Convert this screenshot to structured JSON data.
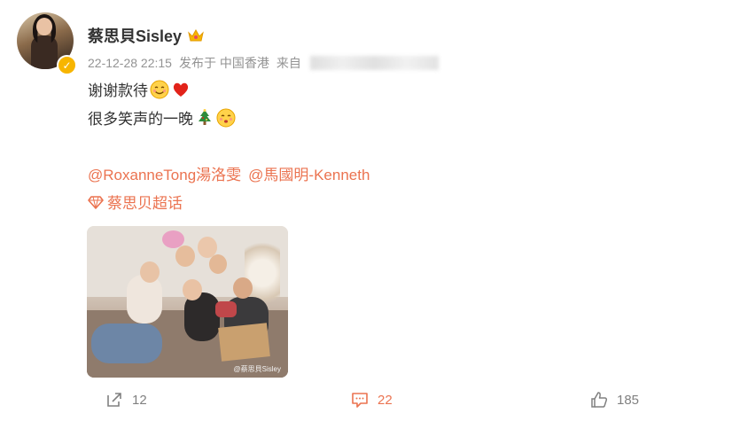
{
  "post": {
    "username": "蔡思貝Sisley",
    "timestamp": "22-12-28 22:15",
    "published_from": "发布于 中国香港",
    "source_label": "来自",
    "content_line1": "谢谢款待",
    "content_line2": "很多笑声的一晚",
    "mentions": [
      "@RoxanneTong湯洛雯",
      "@馬國明-Kenneth"
    ],
    "supertopic": "蔡思贝超话",
    "photo_watermark": "@蔡思貝Sisley",
    "icons": {
      "verified": "verified-badge-icon",
      "crown": "crown-icon",
      "smile": "smile-emoji-icon",
      "heart": "heart-emoji-icon",
      "tree": "christmas-tree-emoji-icon",
      "kiss": "kiss-emoji-icon",
      "diamond": "diamond-icon",
      "repost": "repost-icon",
      "comment": "comment-icon",
      "like": "like-icon"
    }
  },
  "actions": {
    "repost_count": "12",
    "comment_count": "22",
    "like_count": "185"
  },
  "colors": {
    "link": "#eb7350",
    "meta": "#939393",
    "text": "#333333",
    "verified": "#f7b500"
  }
}
